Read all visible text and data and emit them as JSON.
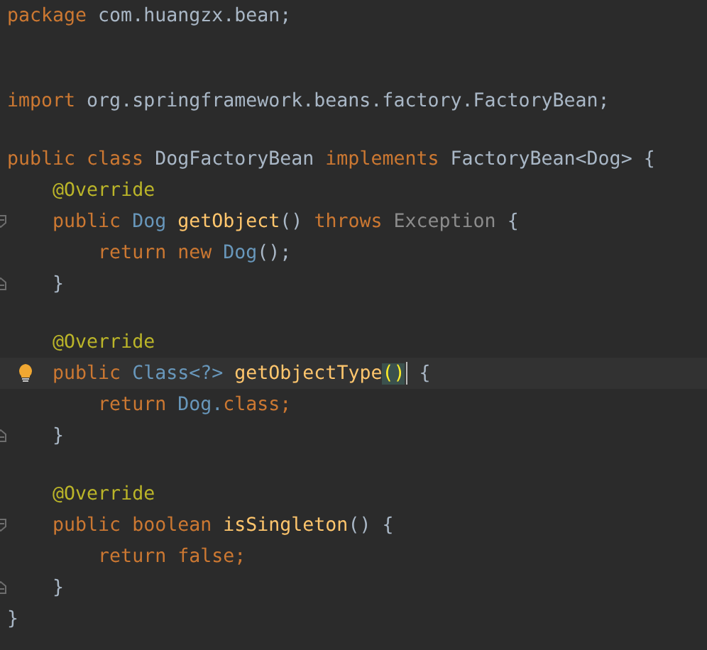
{
  "editor": {
    "sections": [
      {
        "double_gap": true,
        "lines": [
          {
            "tokens": [
              {
                "text": "package ",
                "kind": "keyword"
              },
              {
                "text": "com.huangzx.bean;",
                "kind": "plain"
              }
            ]
          }
        ]
      },
      {
        "double_gap": false,
        "lines": [
          {
            "tokens": [
              {
                "text": "import ",
                "kind": "keyword"
              },
              {
                "text": "org.springframework.beans.factory.FactoryBean;",
                "kind": "plain"
              }
            ]
          }
        ]
      },
      {
        "double_gap": false,
        "lines": [
          {
            "tokens": [
              {
                "text": "public class ",
                "kind": "keyword"
              },
              {
                "text": "DogFactoryBean ",
                "kind": "plain"
              },
              {
                "text": "implements ",
                "kind": "keyword"
              },
              {
                "text": "FactoryBean<Dog> {",
                "kind": "plain"
              }
            ]
          },
          {
            "tokens": [
              {
                "text": "    @Override",
                "kind": "annotation"
              }
            ]
          },
          {
            "fold_start": true,
            "tokens": [
              {
                "text": "    public ",
                "kind": "keyword"
              },
              {
                "text": "Dog ",
                "kind": "type"
              },
              {
                "text": "getObject",
                "kind": "method"
              },
              {
                "text": "() ",
                "kind": "plain"
              },
              {
                "text": "throws ",
                "kind": "keyword"
              },
              {
                "text": "Exception ",
                "kind": "muted"
              },
              {
                "text": "{",
                "kind": "plain"
              }
            ]
          },
          {
            "tokens": [
              {
                "text": "        return new ",
                "kind": "keyword"
              },
              {
                "text": "Dog",
                "kind": "type"
              },
              {
                "text": "();",
                "kind": "plain"
              }
            ]
          },
          {
            "fold_end": true,
            "tokens": [
              {
                "text": "    }",
                "kind": "plain"
              }
            ]
          }
        ]
      },
      {
        "double_gap": false,
        "lines": [
          {
            "tokens": [
              {
                "text": "    @Override",
                "kind": "annotation"
              }
            ]
          },
          {
            "bulb": true,
            "current": true,
            "tokens": [
              {
                "text": "    public ",
                "kind": "keyword"
              },
              {
                "text": "Class<?> ",
                "kind": "type"
              },
              {
                "text": "getObjectType",
                "kind": "method"
              },
              {
                "text": "()",
                "kind": "paren-match",
                "caret": true
              },
              {
                "text": " {",
                "kind": "plain"
              }
            ]
          },
          {
            "tokens": [
              {
                "text": "        return ",
                "kind": "keyword"
              },
              {
                "text": "Dog.",
                "kind": "type"
              },
              {
                "text": "class",
                "kind": "keyword"
              },
              {
                "text": ";",
                "kind": "keyword"
              }
            ]
          },
          {
            "fold_end": true,
            "tokens": [
              {
                "text": "    }",
                "kind": "plain"
              }
            ]
          }
        ]
      },
      {
        "double_gap": false,
        "lines": [
          {
            "tokens": [
              {
                "text": "    @Override",
                "kind": "annotation"
              }
            ]
          },
          {
            "fold_start": true,
            "tokens": [
              {
                "text": "    public boolean ",
                "kind": "keyword"
              },
              {
                "text": "isSingleton",
                "kind": "method"
              },
              {
                "text": "() {",
                "kind": "plain"
              }
            ]
          },
          {
            "tokens": [
              {
                "text": "        return false;",
                "kind": "keyword"
              }
            ]
          },
          {
            "fold_end": true,
            "tokens": [
              {
                "text": "    }",
                "kind": "plain"
              }
            ]
          },
          {
            "tokens": [
              {
                "text": "}",
                "kind": "plain"
              }
            ]
          }
        ]
      }
    ]
  }
}
